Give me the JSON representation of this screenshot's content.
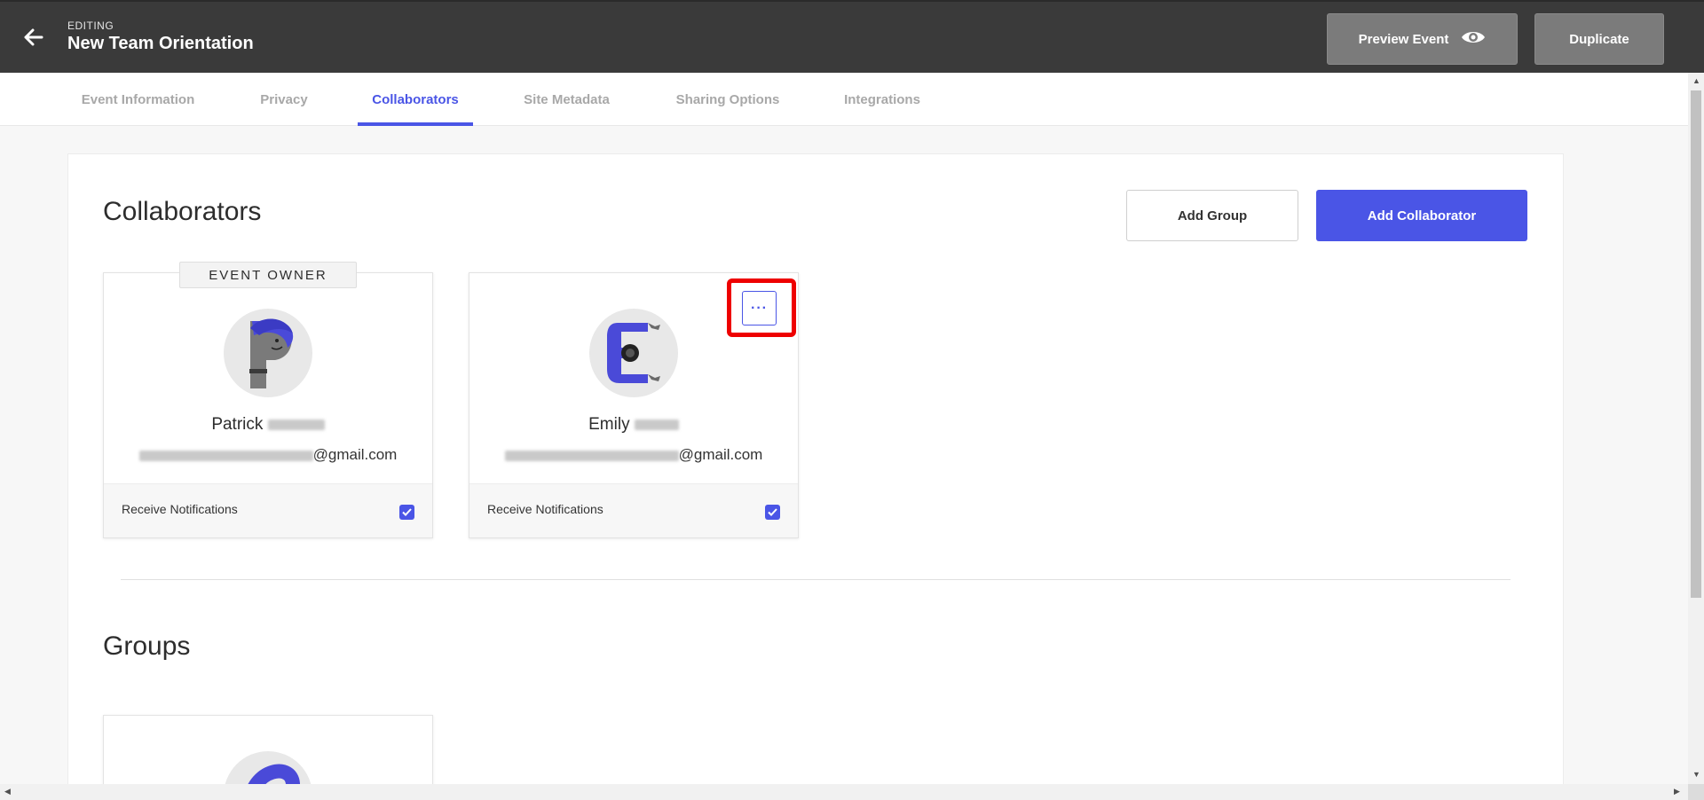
{
  "header": {
    "editing_label": "EDITING",
    "event_title": "New Team Orientation",
    "preview_label": "Preview Event",
    "duplicate_label": "Duplicate"
  },
  "tabs": [
    {
      "label": "Event Information"
    },
    {
      "label": "Privacy"
    },
    {
      "label": "Collaborators",
      "active": true
    },
    {
      "label": "Site Metadata"
    },
    {
      "label": "Sharing Options"
    },
    {
      "label": "Integrations"
    }
  ],
  "collaborators": {
    "title": "Collaborators",
    "add_group_label": "Add Group",
    "add_collaborator_label": "Add Collaborator",
    "cards": [
      {
        "badge": "EVENT OWNER",
        "first_name": "Patrick",
        "email_domain": "@gmail.com",
        "notifications_label": "Receive Notifications",
        "notifications_checked": true,
        "avatar_icon": "letter-p-avatar-icon"
      },
      {
        "first_name": "Emily",
        "email_domain": "@gmail.com",
        "notifications_label": "Receive Notifications",
        "notifications_checked": true,
        "more_label": "···",
        "avatar_icon": "letter-e-avatar-icon"
      }
    ]
  },
  "groups": {
    "title": "Groups"
  },
  "colors": {
    "accent": "#4a55e6",
    "header_bg": "#3a3a3a",
    "highlight": "#ee0000"
  }
}
